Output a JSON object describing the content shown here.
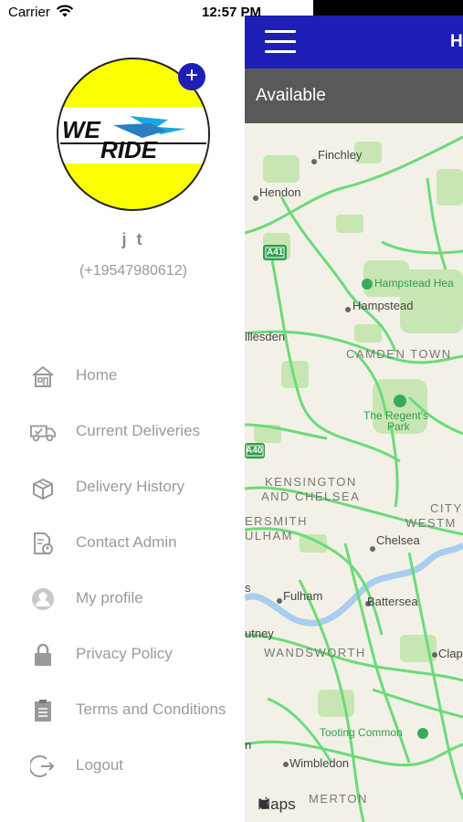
{
  "status_bar": {
    "carrier": "Carrier",
    "time": "12:57 PM"
  },
  "profile": {
    "name": "j t",
    "phone": "(+19547980612)",
    "logo_text": "WE RIDE",
    "add_symbol": "+"
  },
  "menu": [
    {
      "label": "Home",
      "icon": "home-icon"
    },
    {
      "label": "Current Deliveries",
      "icon": "truck-icon"
    },
    {
      "label": "Delivery History",
      "icon": "box-icon"
    },
    {
      "label": "Contact Admin",
      "icon": "contact-admin-icon"
    },
    {
      "label": "My profile",
      "icon": "user-icon"
    },
    {
      "label": "Privacy Policy",
      "icon": "lock-icon"
    },
    {
      "label": "Terms and Conditions",
      "icon": "clipboard-icon"
    },
    {
      "label": "Logout",
      "icon": "logout-icon"
    }
  ],
  "header": {
    "title": "H"
  },
  "status": {
    "label": "Available"
  },
  "map": {
    "labels": {
      "finchley": "Finchley",
      "hendon": "Hendon",
      "a41": "A41",
      "hampstead_heath": "Hampstead Hea",
      "hampstead": "Hampstead",
      "willesden": "illesden",
      "camden": "CAMDEN TOWN",
      "regents_park_1": "The Regent's",
      "regents_park_2": "Park",
      "a40": "A40",
      "kensington_1": "KENSINGTON",
      "kensington_2": "AND CHELSEA",
      "hammersmith_1": "ERSMITH",
      "hammersmith_2": "ULHAM",
      "city_1": "CITY",
      "city_2": "WESTM",
      "chelsea": "Chelsea",
      "s_fragment": "s",
      "fulham": "Fulham",
      "battersea": "Battersea",
      "putney": "utney",
      "wandsworth": "WANDSWORTH",
      "clapham": "Clap",
      "tooting": "Tooting Common",
      "n_fragment": "n",
      "wimbledon": "Wimbledon",
      "merton": "MERTON",
      "credit": "Maps"
    },
    "colors": {
      "land": "#f3f1e7",
      "road": "#6bdb79",
      "river": "#a9cdee",
      "park": "#c8e6b4"
    }
  },
  "colors": {
    "header_blue": "#1d1fb7",
    "status_gray": "#595959",
    "logo_yellow": "#fbff00"
  }
}
